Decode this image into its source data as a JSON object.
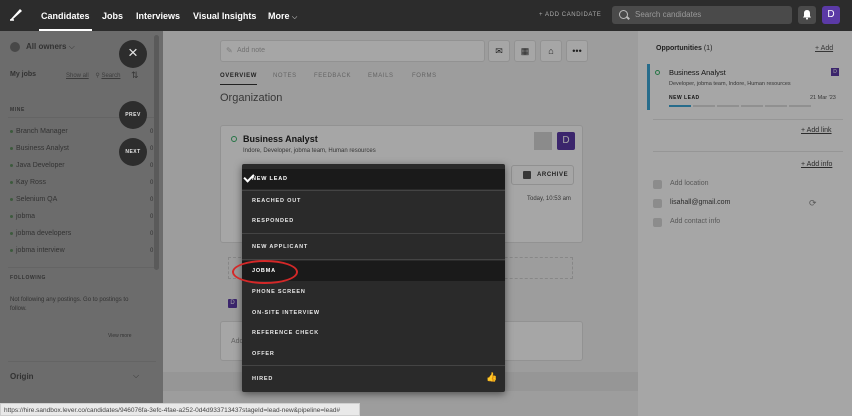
{
  "topnav": {
    "items": [
      "Candidates",
      "Jobs",
      "Interviews",
      "Visual Insights",
      "More"
    ],
    "add_candidate": "+ ADD CANDIDATE",
    "search_placeholder": "Search candidates",
    "avatar_initial": "D"
  },
  "sidebar": {
    "owner": "All owners",
    "my_jobs": "My jobs",
    "show_all": "Show all",
    "search": "Search",
    "mine_label": "MINE",
    "jobs": [
      {
        "name": "Branch Manager",
        "count": "0"
      },
      {
        "name": "Business Analyst",
        "count": "0"
      },
      {
        "name": "Java Developer",
        "count": "0"
      },
      {
        "name": "Kay Ross",
        "count": "0"
      },
      {
        "name": "Selenium QA",
        "count": "0"
      },
      {
        "name": "jobma",
        "count": "0"
      },
      {
        "name": "jobma developers",
        "count": "0"
      },
      {
        "name": "jobma interview",
        "count": "0"
      }
    ],
    "following_label": "FOLLOWING",
    "following_note": "Not following any postings. Go to postings to follow.",
    "view_more": "View more",
    "origin": "Origin",
    "prev": "PREV",
    "next": "NEXT"
  },
  "main": {
    "add_note_placeholder": "Add note",
    "tabs": [
      "OVERVIEW",
      "NOTES",
      "FEEDBACK",
      "EMAILS",
      "FORMS"
    ],
    "section_title": "Organization",
    "card": {
      "title": "Business Analyst",
      "subtitle": "Indore, Developer, jobma team, Human resources",
      "avatar": "D",
      "archive": "ARCHIVE",
      "time": "Today, 10:53 am"
    },
    "card2_text": "Ado"
  },
  "stage_menu": {
    "items": [
      "NEW LEAD",
      "REACHED OUT",
      "RESPONDED",
      "NEW APPLICANT",
      "JOBMA",
      "PHONE SCREEN",
      "ON-SITE INTERVIEW",
      "REFERENCE CHECK",
      "OFFER",
      "HIRED"
    ],
    "selected": "NEW LEAD",
    "highlighted": "JOBMA"
  },
  "right_panel": {
    "opportunities_title": "Opportunities",
    "opportunities_count": "(1)",
    "add": "+ Add",
    "opportunity": {
      "title": "Business Analyst",
      "subtitle": "Developer, jobma team, Indore, Human resources",
      "stage": "NEW LEAD",
      "date": "21 Mar '23",
      "avatar": "D",
      "progress_steps_done": 1,
      "progress_steps_total": 6
    },
    "add_link": "+ Add link",
    "add_info": "+ Add info",
    "add_location": "Add location",
    "email": "lisahall@gmail.com",
    "add_contact_info": "Add contact info"
  },
  "statusbar": {
    "url": "https://hire.sandbox.lever.co/candidates/946076fa-3efc-4fae-a252-0d4d933713437stageId=lead-new&pipeline=lead#"
  },
  "colors": {
    "nav_bg": "#2c2c2c",
    "accent_purple": "#5b3aa6",
    "stage_blue": "#3da6d6",
    "highlight_ring": "#d42828"
  }
}
